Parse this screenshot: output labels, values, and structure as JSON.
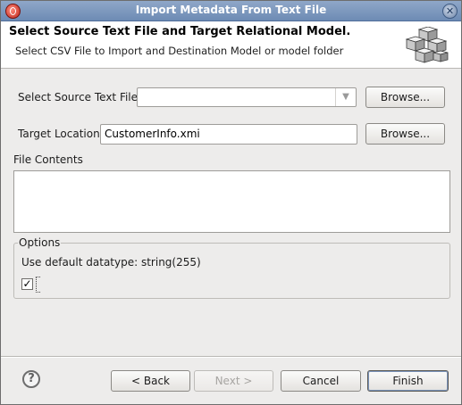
{
  "window": {
    "title": "Import Metadata From Text File"
  },
  "banner": {
    "title": "Select Source Text File and Target Relational Model.",
    "description": "Select CSV File to Import and Destination Model or model folder"
  },
  "source": {
    "label": "Select Source Text File",
    "value": "",
    "browse_label": "Browse..."
  },
  "target": {
    "label": "Target Location",
    "value": "CustomerInfo.xmi",
    "browse_label": "Browse..."
  },
  "file_contents": {
    "label": "File Contents",
    "text": ""
  },
  "options": {
    "title": "Options",
    "datatype_text": "Use default datatype: string(255)",
    "checkbox_checked": true
  },
  "footer": {
    "back_label": "< Back",
    "next_label": "Next >",
    "cancel_label": "Cancel",
    "finish_label": "Finish"
  },
  "icons": {
    "app": "eclipse-app-icon",
    "close": "close-icon",
    "banner": "cubes-icon",
    "help": "help-icon",
    "combo": "chevron-down-icon"
  }
}
